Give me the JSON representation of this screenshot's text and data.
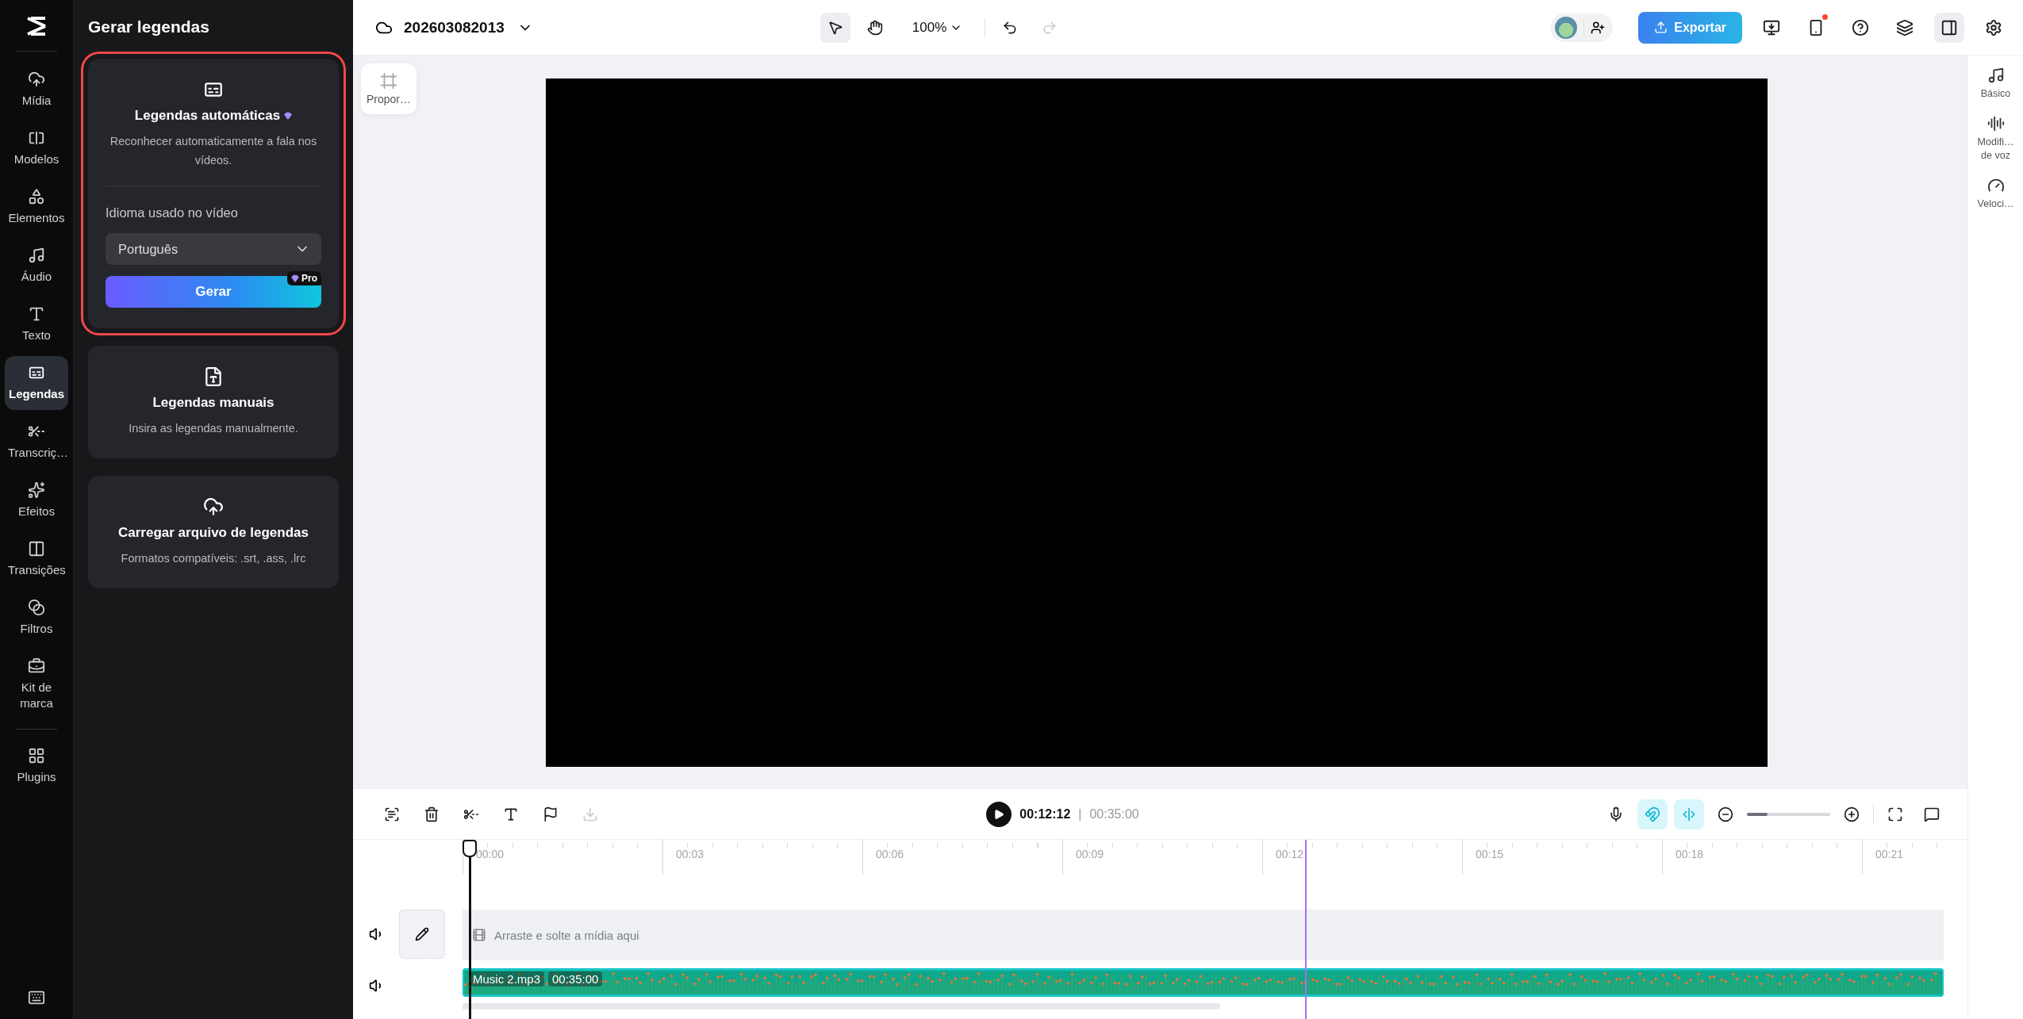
{
  "nav": {
    "items": [
      {
        "label": "Mídia",
        "selected": false
      },
      {
        "label": "Modelos",
        "selected": false
      },
      {
        "label": "Elementos",
        "selected": false
      },
      {
        "label": "Áudio",
        "selected": false
      },
      {
        "label": "Texto",
        "selected": false
      },
      {
        "label": "Legendas",
        "selected": true
      },
      {
        "label": "Transcriç…",
        "selected": false
      },
      {
        "label": "Efeitos",
        "selected": false
      },
      {
        "label": "Transições",
        "selected": false
      },
      {
        "label": "Filtros",
        "selected": false
      },
      {
        "label": "Kit de marca",
        "selected": false
      },
      {
        "label": "Plugins",
        "selected": false
      }
    ]
  },
  "panel": {
    "title": "Gerar legendas",
    "cards": [
      {
        "kind": "auto",
        "highlighted": true,
        "title": "Legendas automáticas",
        "description": "Reconhecer automaticamente a fala nos vídeos.",
        "language_label": "Idioma usado no vídeo",
        "language": "Português",
        "button": "Gerar",
        "badge": "Pro"
      },
      {
        "kind": "manual",
        "highlighted": false,
        "title": "Legendas manuais",
        "description": "Insira as legendas manualmente."
      },
      {
        "kind": "upload",
        "highlighted": false,
        "title": "Carregar arquivo de legendas",
        "description": "Formatos compatíveis: .srt, .ass, .lrc"
      }
    ]
  },
  "topbar": {
    "project_name": "202603082013",
    "zoom": "100%",
    "export": "Exportar",
    "tools": [
      {
        "selected": true
      },
      {
        "selected": false
      }
    ],
    "redo_disabled": true,
    "notification": true
  },
  "canvas": {
    "ratio_button": "Propor…"
  },
  "right_panel": {
    "items": [
      {
        "label": "Básico"
      },
      {
        "label": "Modifi… de voz"
      },
      {
        "label": "Veloci…"
      }
    ]
  },
  "timeline": {
    "current": "00:12:12",
    "separator": "|",
    "total": "00:35:00",
    "toggles": [
      {
        "on": true
      },
      {
        "on": true
      }
    ],
    "zoom_slider": {
      "level": 0.25
    },
    "ruler": [
      "00:00",
      "00:03",
      "00:06",
      "00:09",
      "00:12",
      "00:15",
      "00:18",
      "00:21"
    ],
    "drop_hint": "Arraste e solte a mídia aqui",
    "clip": {
      "name": "Music 2.mp3",
      "duration": "00:35:00"
    }
  }
}
